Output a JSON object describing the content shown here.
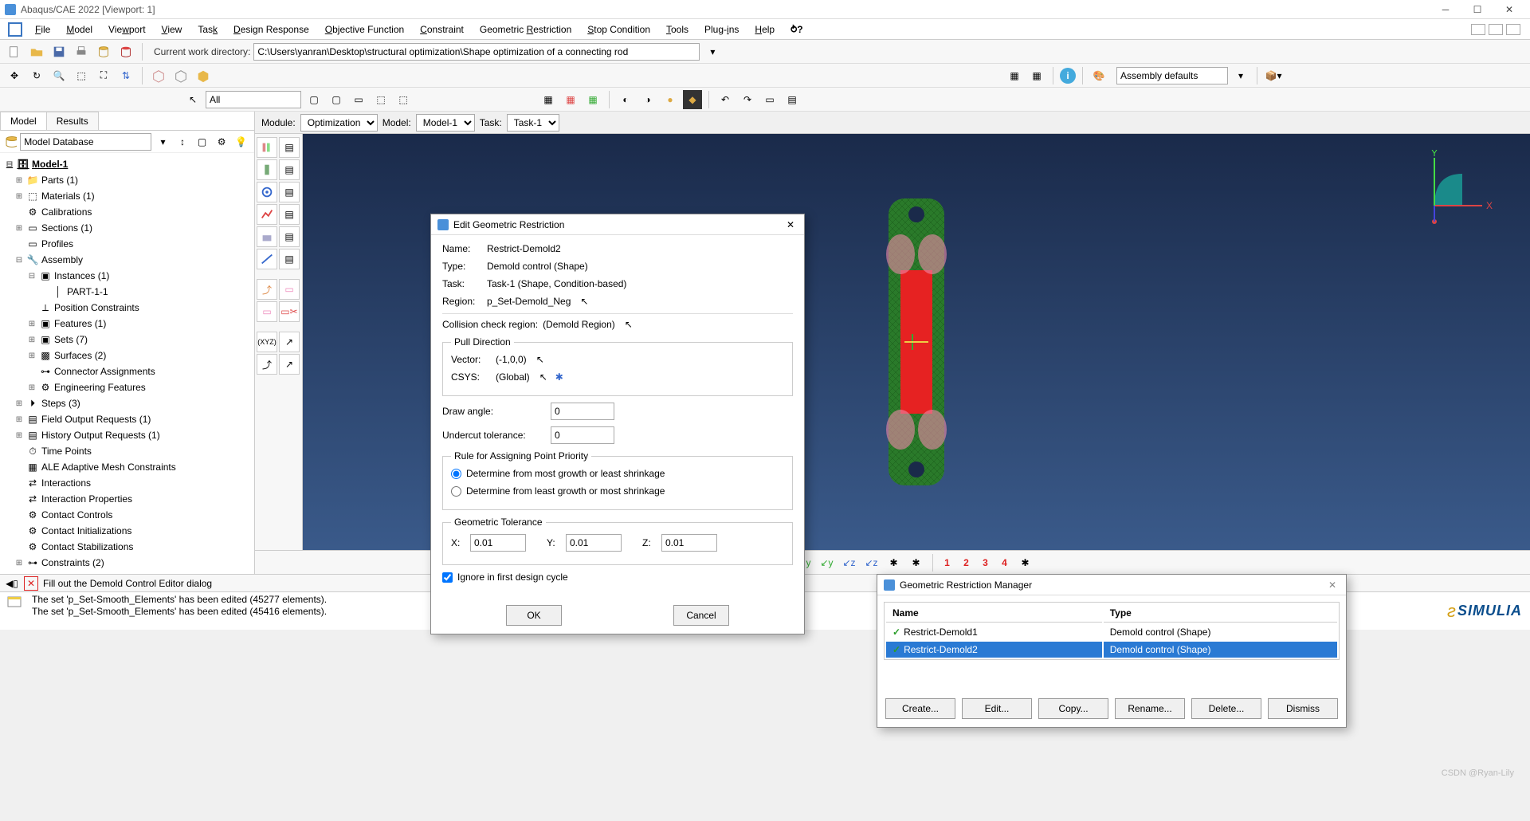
{
  "titlebar": {
    "title": "Abaqus/CAE 2022 [Viewport: 1]"
  },
  "menubar": {
    "items": [
      "File",
      "Model",
      "Viewport",
      "View",
      "Task",
      "Design Response",
      "Objective Function",
      "Constraint",
      "Geometric Restriction",
      "Stop Condition",
      "Tools",
      "Plug-ins",
      "Help"
    ]
  },
  "toolbar1": {
    "cwd_label": "Current work directory:",
    "cwd_value": "C:\\Users\\yanran\\Desktop\\structural optimization\\Shape optimization of a connecting rod"
  },
  "toolbar2": {
    "assembly_label": "Assembly defaults"
  },
  "toolbar3": {
    "all_label": "All",
    "nums": [
      "1",
      "2",
      "3",
      "4"
    ]
  },
  "modulebar": {
    "module_label": "Module:",
    "module_value": "Optimization",
    "model_label": "Model:",
    "model_value": "Model-1",
    "task_label": "Task:",
    "task_value": "Task-1"
  },
  "leftpanel": {
    "tab_model": "Model",
    "tab_results": "Results",
    "db_label": "Model Database",
    "tree": [
      {
        "lvl": 0,
        "exp": "⊟",
        "ic": "db",
        "label": "Model-1",
        "bold": true
      },
      {
        "lvl": 1,
        "exp": "⊞",
        "ic": "folder",
        "label": "Parts (1)"
      },
      {
        "lvl": 1,
        "exp": "⊞",
        "ic": "mat",
        "label": "Materials (1)"
      },
      {
        "lvl": 1,
        "exp": "",
        "ic": "cal",
        "label": "Calibrations"
      },
      {
        "lvl": 1,
        "exp": "⊞",
        "ic": "sec",
        "label": "Sections (1)"
      },
      {
        "lvl": 1,
        "exp": "",
        "ic": "prof",
        "label": "Profiles"
      },
      {
        "lvl": 1,
        "exp": "⊟",
        "ic": "asm",
        "label": "Assembly"
      },
      {
        "lvl": 2,
        "exp": "⊟",
        "ic": "inst",
        "label": "Instances (1)"
      },
      {
        "lvl": 3,
        "exp": "",
        "ic": "part",
        "label": "PART-1-1"
      },
      {
        "lvl": 2,
        "exp": "",
        "ic": "pos",
        "label": "Position Constraints"
      },
      {
        "lvl": 2,
        "exp": "⊞",
        "ic": "feat",
        "label": "Features (1)"
      },
      {
        "lvl": 2,
        "exp": "⊞",
        "ic": "sets",
        "label": "Sets (7)"
      },
      {
        "lvl": 2,
        "exp": "⊞",
        "ic": "surf",
        "label": "Surfaces (2)"
      },
      {
        "lvl": 2,
        "exp": "",
        "ic": "conn",
        "label": "Connector Assignments"
      },
      {
        "lvl": 2,
        "exp": "⊞",
        "ic": "eng",
        "label": "Engineering Features"
      },
      {
        "lvl": 1,
        "exp": "⊞",
        "ic": "steps",
        "label": "Steps (3)"
      },
      {
        "lvl": 1,
        "exp": "⊞",
        "ic": "field",
        "label": "Field Output Requests (1)"
      },
      {
        "lvl": 1,
        "exp": "⊞",
        "ic": "hist",
        "label": "History Output Requests (1)"
      },
      {
        "lvl": 1,
        "exp": "",
        "ic": "time",
        "label": "Time Points"
      },
      {
        "lvl": 1,
        "exp": "",
        "ic": "ale",
        "label": "ALE Adaptive Mesh Constraints"
      },
      {
        "lvl": 1,
        "exp": "",
        "ic": "int",
        "label": "Interactions"
      },
      {
        "lvl": 1,
        "exp": "",
        "ic": "intp",
        "label": "Interaction Properties"
      },
      {
        "lvl": 1,
        "exp": "",
        "ic": "cc",
        "label": "Contact Controls"
      },
      {
        "lvl": 1,
        "exp": "",
        "ic": "ci",
        "label": "Contact Initializations"
      },
      {
        "lvl": 1,
        "exp": "",
        "ic": "cs",
        "label": "Contact Stabilizations"
      },
      {
        "lvl": 1,
        "exp": "⊞",
        "ic": "con",
        "label": "Constraints (2)"
      }
    ]
  },
  "dialog_edit": {
    "title": "Edit Geometric Restriction",
    "name_label": "Name:",
    "name_value": "Restrict-Demold2",
    "type_label": "Type:",
    "type_value": "Demold control (Shape)",
    "task_label": "Task:",
    "task_value": "Task-1 (Shape, Condition-based)",
    "region_label": "Region:",
    "region_value": "p_Set-Demold_Neg",
    "collision_label": "Collision check region:",
    "collision_value": "(Demold Region)",
    "pull_legend": "Pull Direction",
    "vector_label": "Vector:",
    "vector_value": "(-1,0,0)",
    "csys_label": "CSYS:",
    "csys_value": "(Global)",
    "draw_label": "Draw angle:",
    "draw_value": "0",
    "undercut_label": "Undercut tolerance:",
    "undercut_value": "0",
    "rule_legend": "Rule for Assigning Point Priority",
    "rule_opt1": "Determine from most growth or least shrinkage",
    "rule_opt2": "Determine from least growth or most shrinkage",
    "geotol_legend": "Geometric Tolerance",
    "x_label": "X:",
    "x_value": "0.01",
    "y_label": "Y:",
    "y_value": "0.01",
    "z_label": "Z:",
    "z_value": "0.01",
    "ignore_label": "Ignore in first design cycle",
    "ok": "OK",
    "cancel": "Cancel"
  },
  "dialog_mgr": {
    "title": "Geometric Restriction Manager",
    "col_name": "Name",
    "col_type": "Type",
    "rows": [
      {
        "name": "Restrict-Demold1",
        "type": "Demold control (Shape)",
        "sel": false
      },
      {
        "name": "Restrict-Demold2",
        "type": "Demold control (Shape)",
        "sel": true
      }
    ],
    "btns": [
      "Create...",
      "Edit...",
      "Copy...",
      "Rename...",
      "Delete...",
      "Dismiss"
    ]
  },
  "promptbar": {
    "text": "Fill out the Demold Control Editor dialog"
  },
  "msgarea": {
    "line1": "The set 'p_Set-Smooth_Elements' has been edited (45277 elements).",
    "line2": "The set 'p_Set-Smooth_Elements' has been edited (45416 elements)."
  },
  "brand": "SIMULIA",
  "watermark": "CSDN @Ryan-Lily",
  "axis": {
    "x": "X",
    "y": "Y"
  }
}
